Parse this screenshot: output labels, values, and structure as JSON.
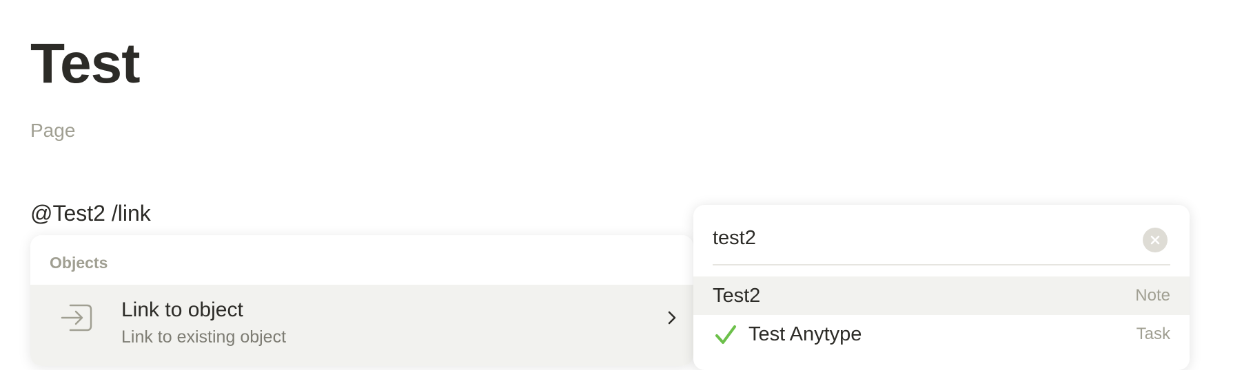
{
  "page": {
    "title": "Test",
    "type_label": "Page",
    "block_text": "@Test2 /link"
  },
  "menu": {
    "section_label": "Objects",
    "items": [
      {
        "title": "Link to object",
        "description": "Link to existing object",
        "icon": "link-to-object-icon"
      }
    ]
  },
  "search": {
    "query": "test2",
    "results": [
      {
        "name": "Test2",
        "type": "Note",
        "icon": null
      },
      {
        "name": "Test Anytype",
        "type": "Task",
        "icon": "checkmark-icon"
      }
    ]
  },
  "colors": {
    "text": "#2c2b27",
    "muted": "#a09f92",
    "selected_bg": "#f2f2ef",
    "check_green": "#6cc04a"
  }
}
